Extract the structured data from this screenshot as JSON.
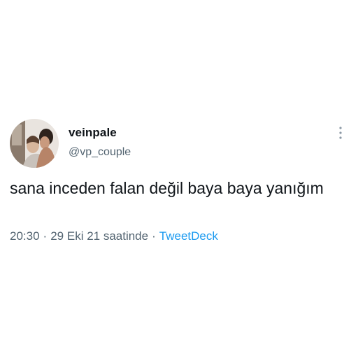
{
  "author": {
    "display_name": "veinpale",
    "handle": "@vp_couple",
    "avatar_icon": "avatar-photo"
  },
  "tweet": {
    "text": "sana inceden falan değil baya baya yanığım"
  },
  "meta": {
    "time": "20:30",
    "separator": "·",
    "date_text": "29 Eki 21 saatinde",
    "source": "TweetDeck"
  },
  "actions": {
    "more_icon": "more-options-icon"
  },
  "colors": {
    "text_primary": "#0f1419",
    "text_secondary": "#536471",
    "link": "#1d9bf0"
  }
}
